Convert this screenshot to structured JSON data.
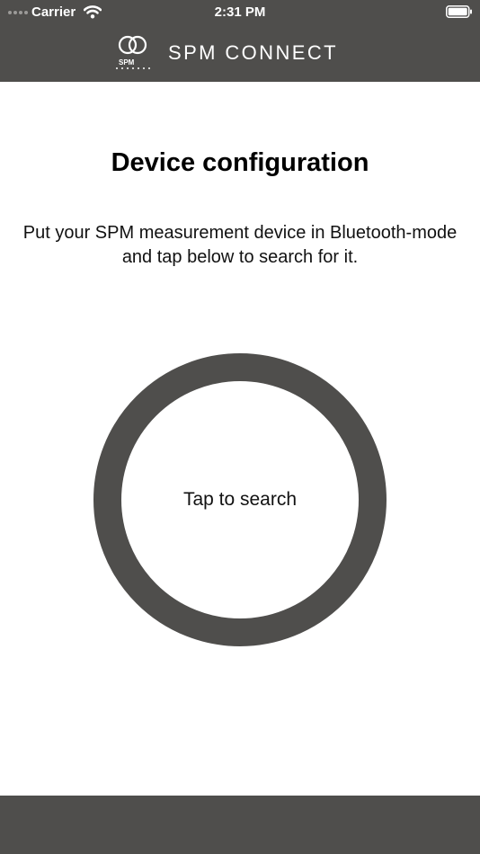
{
  "status_bar": {
    "carrier": "Carrier",
    "time": "2:31 PM",
    "wifi_icon": "wifi-icon",
    "battery_icon": "battery-icon"
  },
  "header": {
    "logo_text": "SPM",
    "title": "SPM CONNECT",
    "background": "#4f4e4c"
  },
  "main": {
    "title": "Device configuration",
    "instructions": "Put your SPM measurement device in Bluetooth-mode and tap below to search for it.",
    "search_button_label": "Tap to search",
    "ring_color": "#4f4e4c"
  },
  "footer": {
    "background": "#4f4e4c"
  }
}
